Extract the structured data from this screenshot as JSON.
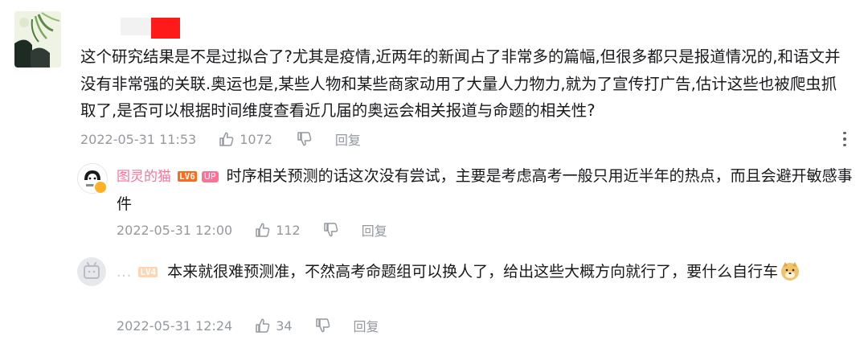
{
  "comment": {
    "text": "这个研究结果是不是过拟合了?尤其是疫情,近两年的新闻占了非常多的篇幅,但很多都只是报道情况的,和语文并没有非常强的关联.奥运也是,某些人物和某些商家动用了大量人力物力,就为了宣传打广告,估计这些也被爬虫抓取了,是否可以根据时间维度查看近几届的奥运会相关报道与命题的相关性?",
    "time": "2022-05-31 11:53",
    "likes": "1072",
    "reply_label": "回复"
  },
  "replies": [
    {
      "username": "图灵的猫",
      "level_badge": "LV6",
      "up_badge": "UP",
      "text": "时序相关预测的话这次没有尝试，主要是考虑高考一般只用近半年的热点，而且会避开敏感事件",
      "time": "2022-05-31 12:00",
      "likes": "112",
      "reply_label": "回复",
      "avatar_label": "图灵的猫"
    },
    {
      "username": "...",
      "level_badge": "LV4",
      "text": "本来就很难预测准，不然高考命题组可以换人了，给出这些大概方向就行了，要什么自行车",
      "time": "2022-05-31 12:24",
      "likes": "34",
      "reply_label": "回复",
      "emoji": "doge-emoji"
    }
  ],
  "colors": {
    "text": "#18191c",
    "meta": "#9499a0",
    "up_pink": "#fb7299",
    "lv6_orange": "#ff6a1a",
    "lv4_peach": "#ffd5b3",
    "redaction_red": "#ff1a1a"
  },
  "icons": [
    "thumb-up-icon",
    "thumb-down-icon",
    "more-options-icon",
    "doge-emoji"
  ]
}
